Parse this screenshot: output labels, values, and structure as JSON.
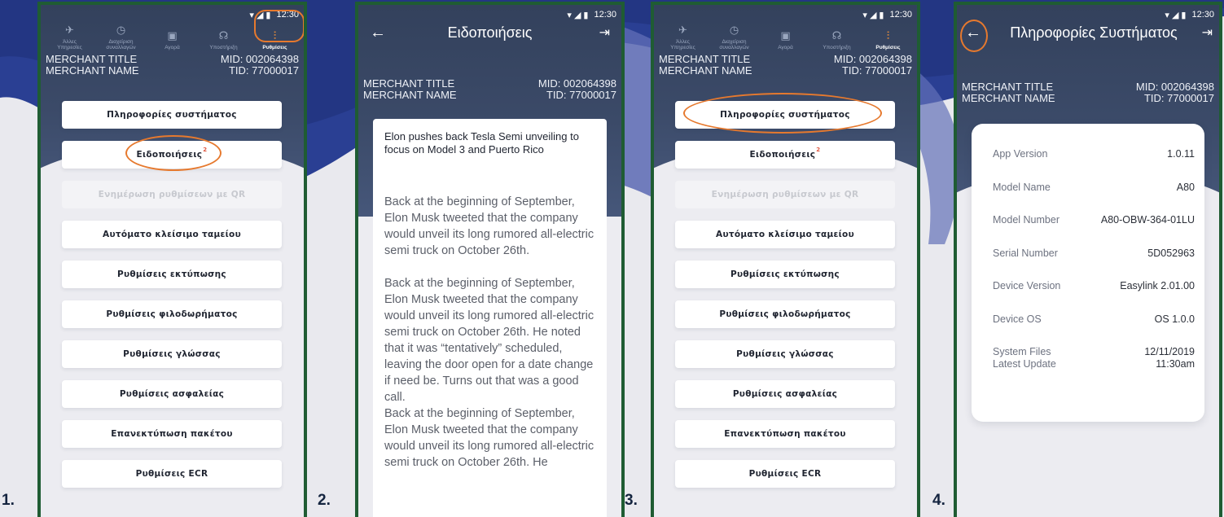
{
  "steps": [
    "1.",
    "2.",
    "3.",
    "4."
  ],
  "status": {
    "time": "12:30"
  },
  "merchant": {
    "title": "MERCHANT TITLE",
    "name": "MERCHANT NAME",
    "mid": "MID: 002064398",
    "tid": "TID: 77000017"
  },
  "topnav": {
    "items": [
      {
        "label1": "Άλλες",
        "label2": "Υπηρεσίες",
        "icon": "plane-icon"
      },
      {
        "label1": "Διαχείριση",
        "label2": "συναλλαγών",
        "icon": "clock-icon"
      },
      {
        "label1": "Αγορά",
        "label2": "",
        "icon": "bag-icon"
      },
      {
        "label1": "Υποστήριξη",
        "label2": "",
        "icon": "support-icon"
      },
      {
        "label1": "Ρυθμίσεις",
        "label2": "",
        "icon": "sliders-icon"
      }
    ]
  },
  "menu": {
    "items": [
      "Πληροφορίες συστήματος",
      "Ειδοποιήσεις",
      "Ενημέρωση ρυθμίσεων με QR",
      "Αυτόματο κλείσιμο ταμείου",
      "Ρυθμίσεις εκτύπωσης",
      "Ρυθμίσεις φιλοδωρήματος",
      "Ρυθμίσεις γλώσσας",
      "Ρυθμίσεις ασφαλείας",
      "Επανεκτύπωση πακέτου",
      "Ρυθμίσεις ECR"
    ],
    "badge": "2"
  },
  "notifications": {
    "title": "Ειδοποιήσεις",
    "headline": "Elon pushes back Tesla Semi unveiling to focus on Model 3 and Puerto Rico",
    "para1": "Back at the beginning of September, Elon Musk tweeted that the company would unveil its long rumored all-electric semi truck on October 26th.",
    "para2": "Back at the beginning of September, Elon Musk tweeted that the company would unveil its long rumored all-electric semi truck on October 26th. He noted that it was “tentatively” scheduled, leaving the door open for a date change if need be. Turns out that was a good call.",
    "para3": "Back at the beginning of September, Elon Musk tweeted that the company would unveil its long rumored all-electric semi truck on October 26th. He"
  },
  "system_info": {
    "title": "Πληροφορίες Συστήματος",
    "rows": [
      {
        "label": "App Version",
        "value": "1.0.11"
      },
      {
        "label": "Model Name",
        "value": "A80"
      },
      {
        "label": "Model Number",
        "value": "A80-OBW-364-01LU"
      },
      {
        "label": "Serial Number",
        "value": "5D052963"
      },
      {
        "label": "Device Version",
        "value": "Easylink 2.01.00"
      },
      {
        "label": "Device OS",
        "value": "OS 1.0.0"
      }
    ],
    "files_label1": "System Files",
    "files_label2": "Latest Update",
    "files_date": "12/11/2019",
    "files_time": "11:30am"
  },
  "colors": {
    "frame": "#1f5c33",
    "header": "#33415c",
    "highlight": "#e6792e",
    "bg_wave": "#3d4fa0"
  }
}
